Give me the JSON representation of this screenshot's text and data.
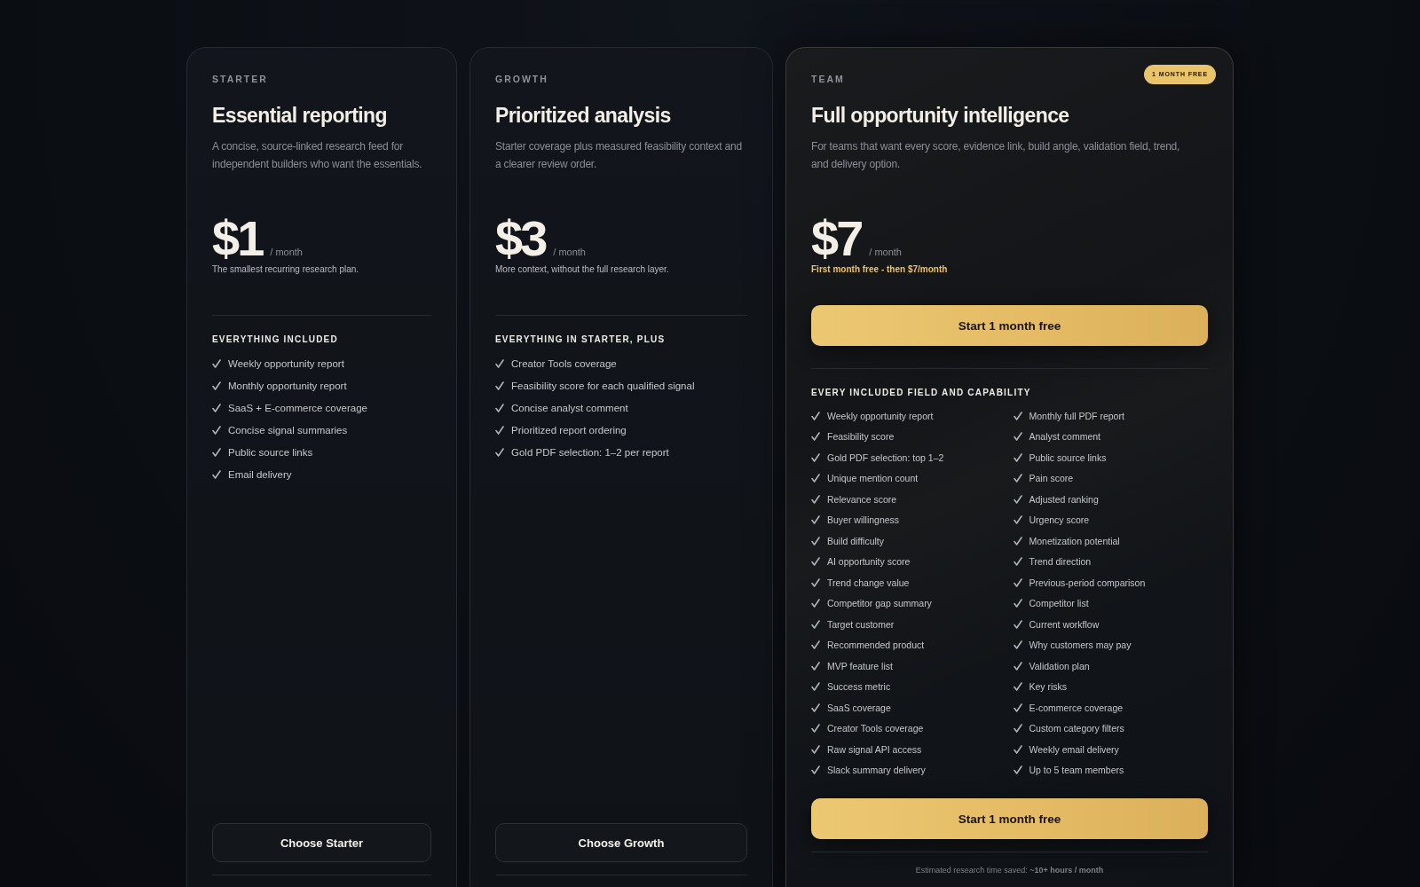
{
  "plans": [
    {
      "tier": "STARTER",
      "title": "Essential reporting",
      "description": "A concise, source-linked research feed for independent builders who want the essentials.",
      "price": "$1",
      "period": "/ month",
      "note": "The smallest recurring research plan.",
      "featured": false,
      "features_heading": "EVERYTHING INCLUDED",
      "features": [
        "Weekly opportunity report",
        "Monthly opportunity report",
        "SaaS + E-commerce coverage",
        "Concise signal summaries",
        "Public source links",
        "Email delivery"
      ],
      "button": "Choose Starter"
    },
    {
      "tier": "GROWTH",
      "title": "Prioritized analysis",
      "description": "Starter coverage plus measured feasibility context and a clearer review order.",
      "price": "$3",
      "period": "/ month",
      "note": "More context, without the full research layer.",
      "featured": false,
      "features_heading": "EVERYTHING IN STARTER, PLUS",
      "features": [
        "Creator Tools coverage",
        "Feasibility score for each qualified signal",
        "Concise analyst comment",
        "Prioritized report ordering",
        "Gold PDF selection: 1–2 per report"
      ],
      "button": "Choose Growth"
    },
    {
      "tier": "TEAM",
      "badge": "1 MONTH FREE",
      "title": "Full opportunity intelligence",
      "description": "For teams that want every score, evidence link, build angle, validation field, trend, and delivery option.",
      "price": "$7",
      "period": "/ month",
      "note": "First month free - then $7/month",
      "featured": true,
      "top_button": "Start 1 month free",
      "features_heading": "EVERY INCLUDED FIELD AND CAPABILITY",
      "features": [
        "Weekly opportunity report",
        "Monthly full PDF report",
        "Feasibility score",
        "Analyst comment",
        "Gold PDF selection: top 1–2",
        "Public source links",
        "Unique mention count",
        "Pain score",
        "Relevance score",
        "Adjusted ranking",
        "Buyer willingness",
        "Urgency score",
        "Build difficulty",
        "Monetization potential",
        "AI opportunity score",
        "Trend direction",
        "Trend change value",
        "Previous-period comparison",
        "Competitor gap summary",
        "Competitor list",
        "Target customer",
        "Current workflow",
        "Recommended product",
        "Why customers may pay",
        "MVP feature list",
        "Validation plan",
        "Success metric",
        "Key risks",
        "SaaS coverage",
        "E-commerce coverage",
        "Creator Tools coverage",
        "Custom category filters",
        "Raw signal API access",
        "Weekly email delivery",
        "Slack summary delivery",
        "Up to 5 team members"
      ],
      "button": "Start 1 month free",
      "footnote": "Estimated research time saved: **~10+ hours / month**"
    }
  ]
}
